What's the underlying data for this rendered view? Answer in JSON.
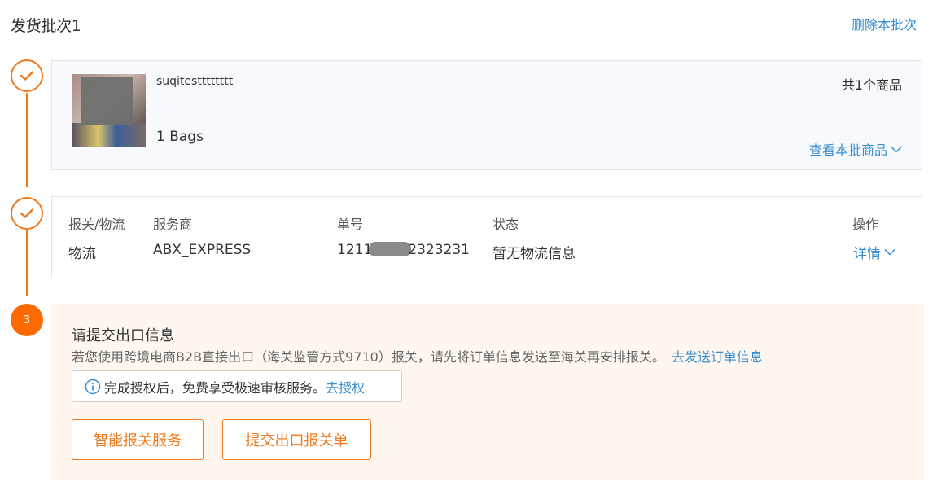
{
  "batch": {
    "title": "发货批次1",
    "delete_label": "删除本批次"
  },
  "steps": {
    "step3_number": "3"
  },
  "product": {
    "name": "suqitestttttttt",
    "quantity": "1 Bags",
    "count_label": "共1个商品",
    "view_link": "查看本批商品"
  },
  "logistics": {
    "headers": [
      "报关/物流",
      "服务商",
      "单号",
      "状态",
      "操作"
    ],
    "row": {
      "type": "物流",
      "provider": "ABX_EXPRESS",
      "tracking_prefix": "1211",
      "tracking_suffix": "2323231",
      "status": "暂无物流信息",
      "details_link": "详情"
    }
  },
  "export": {
    "title": "请提交出口信息",
    "description": "若您使用跨境电商B2B直接出口（海关监管方式9710）报关，请先将订单信息发送至海关再安排报关。",
    "send_order_link": "去发送订单信息",
    "auth_notice": "完成授权后，免费享受极速审核服务。",
    "auth_link": "去授权",
    "smart_customs_button": "智能报关服务",
    "submit_declaration_button": "提交出口报关单"
  },
  "colors": {
    "accent_orange": "#f07a1d",
    "link_blue": "#3a8ed0",
    "export_bg": "#fff7ef"
  }
}
